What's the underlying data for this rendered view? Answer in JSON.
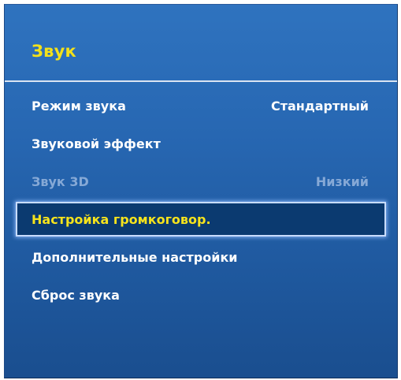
{
  "menu": {
    "title": "Звук",
    "items": [
      {
        "label": "Режим звука",
        "value": "Стандартный",
        "state": "normal"
      },
      {
        "label": "Звуковой эффект",
        "value": "",
        "state": "normal"
      },
      {
        "label": "Звук 3D",
        "value": "Низкий",
        "state": "disabled"
      },
      {
        "label": "Настройка громкоговор.",
        "value": "",
        "state": "selected"
      },
      {
        "label": "Дополнительные настройки",
        "value": "",
        "state": "normal"
      },
      {
        "label": "Сброс звука",
        "value": "",
        "state": "normal"
      }
    ]
  },
  "colors": {
    "panel_background": "#2767b2",
    "title_text": "#f3e11a",
    "item_text": "#ffffff",
    "disabled_text": "#86a9d6",
    "selected_background": "#0b3a70",
    "selected_text": "#f6e31c"
  }
}
